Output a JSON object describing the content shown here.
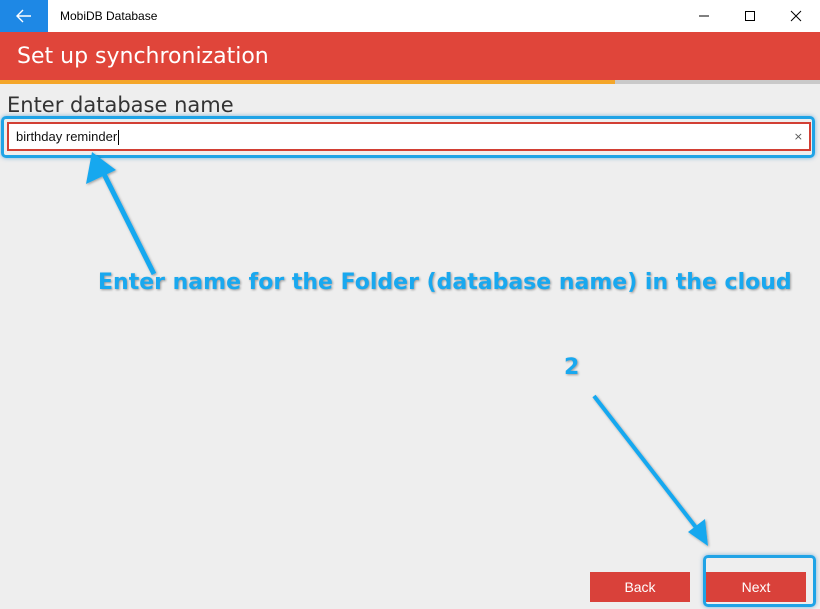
{
  "window": {
    "title": "MobiDB Database"
  },
  "header": {
    "title": "Set up synchronization",
    "progress_fraction": 0.75
  },
  "form": {
    "label": "Enter database name",
    "value": "birthday reminder",
    "clear_glyph": "×"
  },
  "annotations": {
    "main_text": "Enter name for the Folder (database name) in the cloud",
    "step_number": "2"
  },
  "buttons": {
    "back": "Back",
    "next": "Next"
  },
  "colors": {
    "header": "#e0453a",
    "back_button": "#1e88e5",
    "progress": "#f4a62a",
    "annotation": "#19a8ef",
    "action_button": "#d9413a"
  },
  "icons": {
    "back": "back-arrow-icon",
    "minimize": "minimize-icon",
    "maximize": "maximize-icon",
    "close": "close-icon"
  }
}
